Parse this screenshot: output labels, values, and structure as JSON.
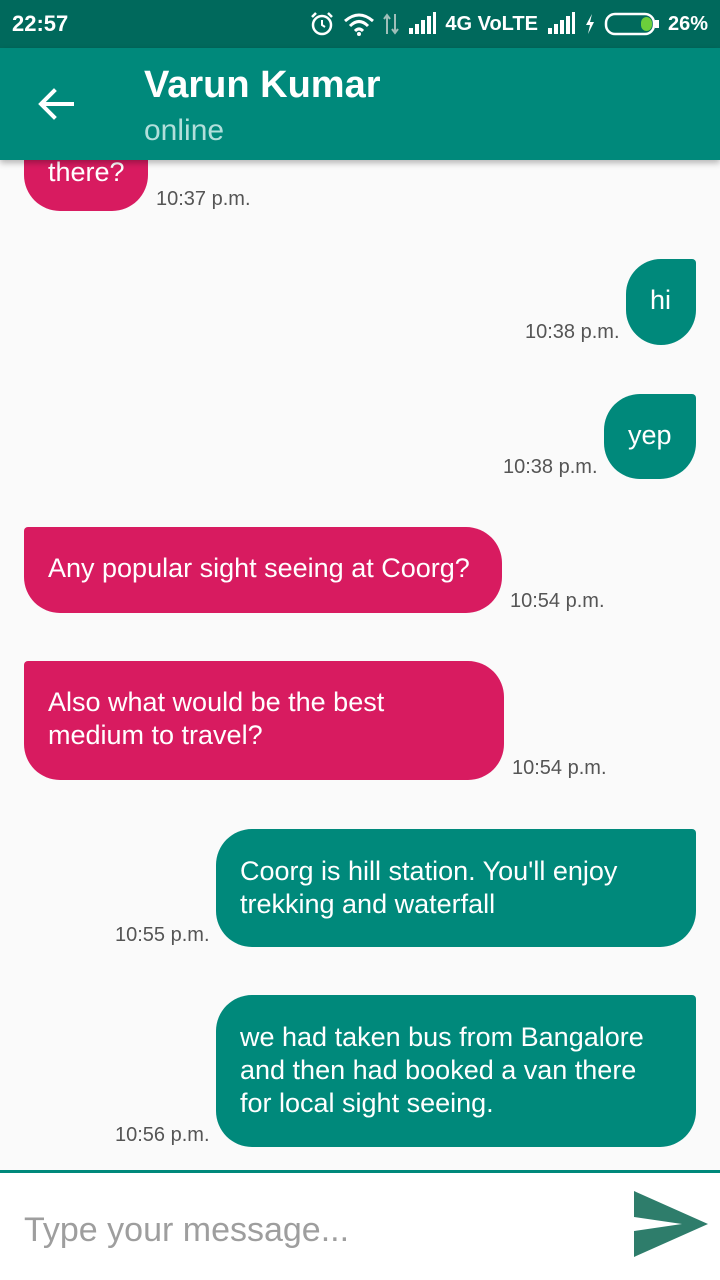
{
  "status_bar": {
    "time": "22:57",
    "network": "4G VoLTE",
    "battery": "26%",
    "battery_level": 0.26,
    "icons": [
      "alarm-icon",
      "wifi-icon",
      "data-arrows-icon",
      "signal-icon",
      "signal-icon",
      "charging-icon",
      "battery-icon"
    ]
  },
  "header": {
    "back_icon": "arrow-left-icon",
    "contact_name": "Varun Kumar",
    "contact_status": "online"
  },
  "messages": [
    {
      "direction": "incoming",
      "text": "there?",
      "time": "10:37 p.m."
    },
    {
      "direction": "outgoing",
      "text": "hi",
      "time": "10:38 p.m."
    },
    {
      "direction": "outgoing",
      "text": "yep",
      "time": "10:38 p.m."
    },
    {
      "direction": "incoming",
      "text": "Any popular sight seeing at Coorg?",
      "time": "10:54 p.m."
    },
    {
      "direction": "incoming",
      "text": "Also what would be the best medium to travel?",
      "time": "10:54 p.m."
    },
    {
      "direction": "outgoing",
      "text": "Coorg is hill station. You'll enjoy trekking and waterfall",
      "time": "10:55 p.m."
    },
    {
      "direction": "outgoing",
      "text": "we had taken bus from Bangalore and then had booked a van there for local sight seeing.",
      "time": "10:56 p.m."
    }
  ],
  "composer": {
    "placeholder": "Type your message...",
    "value": "",
    "send_icon": "send-icon"
  },
  "colors": {
    "status_bar": "#00695c",
    "toolbar": "#00897b",
    "incoming_bubble": "#d81b60",
    "outgoing_bubble": "#00897b",
    "send_icon": "#2e7d6b"
  }
}
